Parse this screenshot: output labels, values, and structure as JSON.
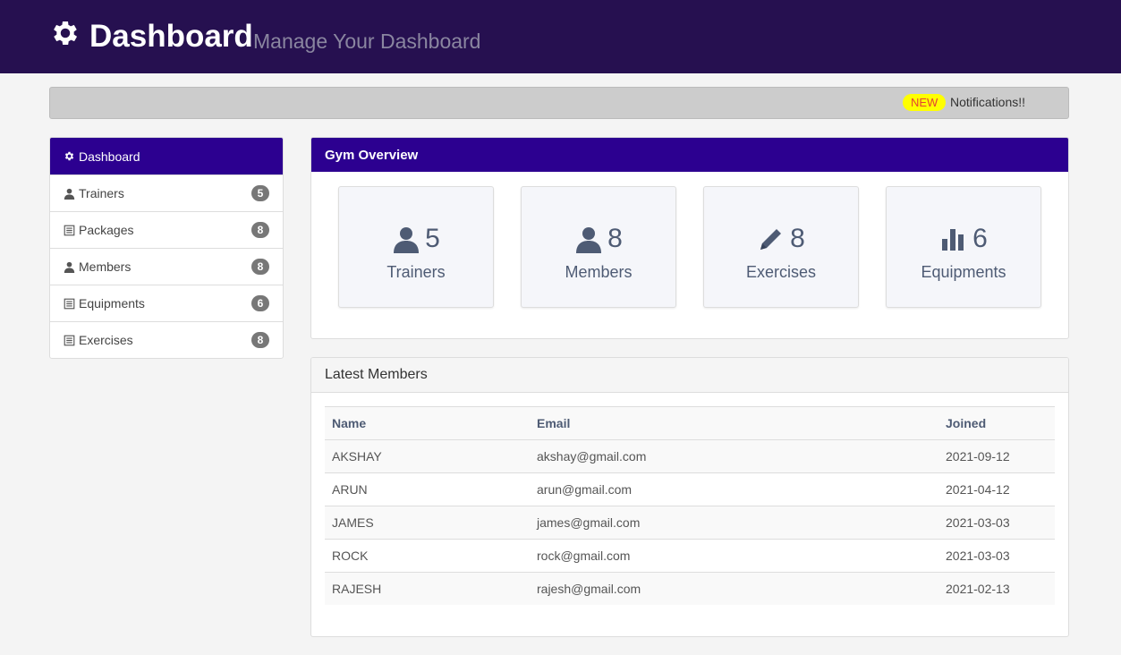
{
  "header": {
    "title": "Dashboard",
    "subtitle": "Manage Your Dashboard",
    "icon": "gear-icon",
    "bg_color": "#261050"
  },
  "notification_bar": {
    "badge": "NEW",
    "text": "Notifications!!",
    "badge_color": "#ffff00"
  },
  "sidebar": {
    "active": {
      "label": "Dashboard",
      "icon": "gear-icon"
    },
    "items": [
      {
        "label": "Trainers",
        "icon": "user-icon",
        "count": "5"
      },
      {
        "label": "Packages",
        "icon": "list-icon",
        "count": "8"
      },
      {
        "label": "Members",
        "icon": "user-icon",
        "count": "8"
      },
      {
        "label": "Equipments",
        "icon": "list-icon",
        "count": "6"
      },
      {
        "label": "Exercises",
        "icon": "list-icon",
        "count": "8"
      }
    ],
    "accent_color": "#2c0090"
  },
  "overview": {
    "title": "Gym Overview",
    "cards": [
      {
        "label": "Trainers",
        "value": "5",
        "icon": "user-icon"
      },
      {
        "label": "Members",
        "value": "8",
        "icon": "user-icon"
      },
      {
        "label": "Exercises",
        "value": "8",
        "icon": "pencil-icon"
      },
      {
        "label": "Equipments",
        "value": "6",
        "icon": "bar-chart-icon"
      }
    ]
  },
  "latest_members": {
    "title": "Latest Members",
    "columns": [
      "Name",
      "Email",
      "Joined"
    ],
    "rows": [
      [
        "AKSHAY",
        "akshay@gmail.com",
        "2021-09-12"
      ],
      [
        "ARUN",
        "arun@gmail.com",
        "2021-04-12"
      ],
      [
        "JAMES",
        "james@gmail.com",
        "2021-03-03"
      ],
      [
        "ROCK",
        "rock@gmail.com",
        "2021-03-03"
      ],
      [
        "RAJESH",
        "rajesh@gmail.com",
        "2021-02-13"
      ]
    ]
  }
}
